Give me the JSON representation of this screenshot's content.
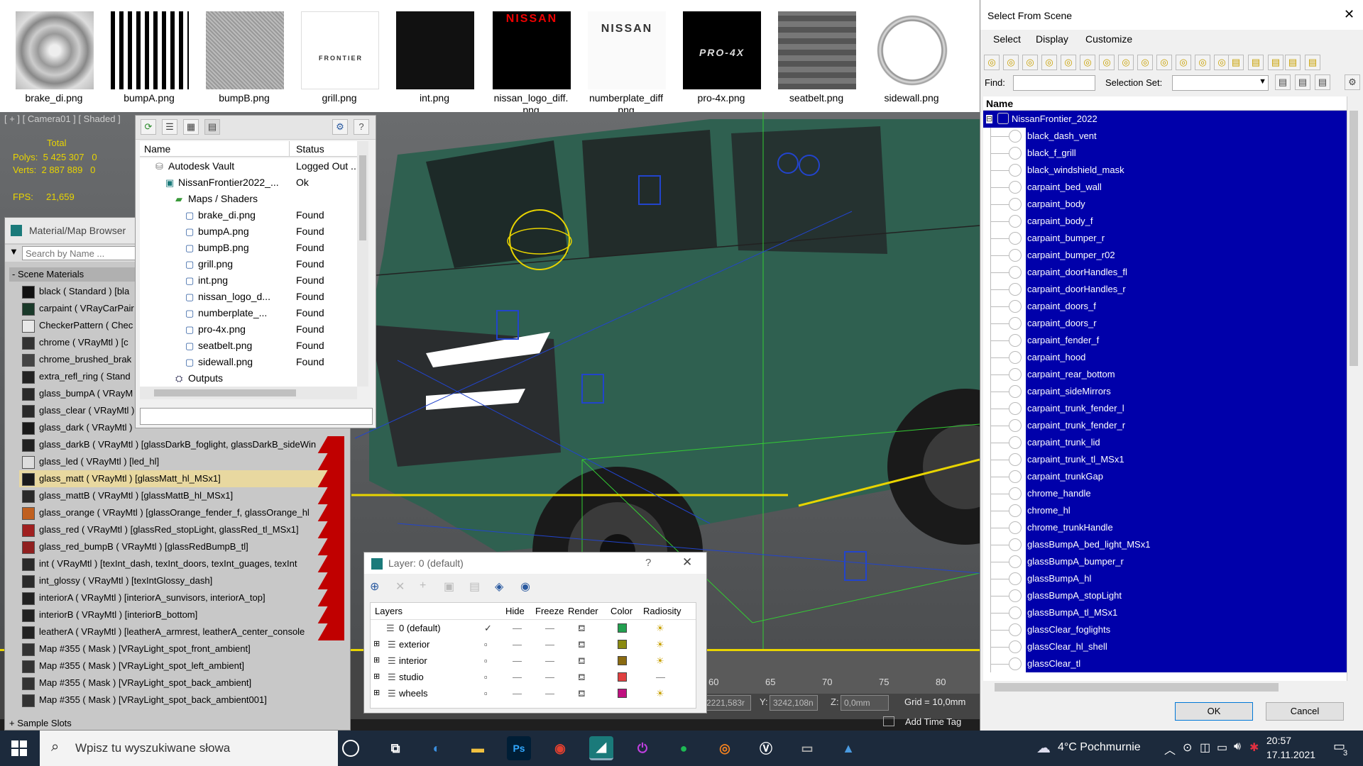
{
  "thumbnails": [
    {
      "caption": "brake_di.png",
      "cap2": ""
    },
    {
      "caption": "bumpA.png",
      "cap2": ""
    },
    {
      "caption": "bumpB.png",
      "cap2": ""
    },
    {
      "caption": "grill.png",
      "cap2": "",
      "text": "FRONTIER"
    },
    {
      "caption": "int.png",
      "cap2": ""
    },
    {
      "caption": "nissan_logo_diff.",
      "cap2": "png",
      "text": "NISSAN"
    },
    {
      "caption": "numberplate_diff",
      "cap2": "png",
      "text": "NISSAN"
    },
    {
      "caption": "pro-4x.png",
      "cap2": "",
      "text": "PRO-4X"
    },
    {
      "caption": "seatbelt.png",
      "cap2": ""
    },
    {
      "caption": "sidewall.png",
      "cap2": ""
    }
  ],
  "viewport": {
    "label": "[ + ] [ Camera01 ] [ Shaded ]",
    "stats_total": "Total",
    "polys_label": "Polys:",
    "polys_value": "5 425 307",
    "polys_sel": "0",
    "verts_label": "Verts:",
    "verts_value": "2 887 889",
    "verts_sel": "0",
    "fps_label": "FPS:",
    "fps_value": "21,659",
    "ruler": [
      "60",
      "65",
      "70",
      "75",
      "80"
    ],
    "coord_x": "2221,583r",
    "coord_y_label": "Y:",
    "coord_y": "3242,108n",
    "coord_z_label": "Z:",
    "coord_z": "0,0mm",
    "grid": "Grid = 10,0mm",
    "add_time_tag": "Add Time Tag"
  },
  "material_browser": {
    "title": "Material/Map Browser",
    "search_placeholder": "Search by Name ...",
    "section": "- Scene Materials",
    "sample_slots": "+ Sample Slots",
    "items": [
      {
        "label": "black ( Standard ) [bla",
        "red": false
      },
      {
        "label": "carpaint ( VRayCarPair",
        "red": false
      },
      {
        "label": "CheckerPattern ( Chec",
        "red": false
      },
      {
        "label": "chrome ( VRayMtl ) [c",
        "red": false
      },
      {
        "label": "chrome_brushed_brak",
        "red": false
      },
      {
        "label": "extra_refl_ring ( Stand",
        "red": false
      },
      {
        "label": "glass_bumpA ( VRayM",
        "red": false
      },
      {
        "label": "glass_clear ( VRayMtl )",
        "red": false
      },
      {
        "label": "glass_dark ( VRayMtl )",
        "red": false
      },
      {
        "label": "glass_darkB ( VRayMtl ) [glassDarkB_foglight, glassDarkB_sideWin",
        "red": true
      },
      {
        "label": "glass_led ( VRayMtl ) [led_hl]",
        "red": true
      },
      {
        "label": "glass_matt ( VRayMtl ) [glassMatt_hl_MSx1]",
        "red": true,
        "highlight": true
      },
      {
        "label": "glass_mattB ( VRayMtl ) [glassMattB_hl_MSx1]",
        "red": true
      },
      {
        "label": "glass_orange ( VRayMtl ) [glassOrange_fender_f, glassOrange_hl",
        "red": true
      },
      {
        "label": "glass_red ( VRayMtl ) [glassRed_stopLight, glassRed_tl_MSx1]",
        "red": true
      },
      {
        "label": "glass_red_bumpB ( VRayMtl ) [glassRedBumpB_tl]",
        "red": true
      },
      {
        "label": "int ( VRayMtl ) [texInt_dash, texInt_doors, texInt_guages, texInt",
        "red": true
      },
      {
        "label": "int_glossy ( VRayMtl ) [texIntGlossy_dash]",
        "red": true
      },
      {
        "label": "interiorA ( VRayMtl ) [interiorA_sunvisors, interiorA_top]",
        "red": true
      },
      {
        "label": "interiorB ( VRayMtl ) [interiorB_bottom]",
        "red": true
      },
      {
        "label": "leatherA ( VRayMtl ) [leatherA_armrest, leatherA_center_console",
        "red": true
      },
      {
        "label": "Map #355 ( Mask ) [VRayLight_spot_front_ambient]",
        "red": false
      },
      {
        "label": "Map #355 ( Mask ) [VRayLight_spot_left_ambient]",
        "red": false
      },
      {
        "label": "Map #355 ( Mask ) [VRayLight_spot_back_ambient]",
        "red": false
      },
      {
        "label": "Map #355 ( Mask ) [VRayLight_spot_back_ambient001]",
        "red": false
      }
    ]
  },
  "asset_tracking": {
    "col_name": "Name",
    "col_status": "Status",
    "rows": [
      {
        "name": "Autodesk Vault",
        "status": "Logged Out ..",
        "indent": 1
      },
      {
        "name": "NissanFrontier2022_...",
        "status": "Ok",
        "indent": 2
      },
      {
        "name": "Maps / Shaders",
        "status": "",
        "indent": 3
      },
      {
        "name": "brake_di.png",
        "status": "Found",
        "indent": 4
      },
      {
        "name": "bumpA.png",
        "status": "Found",
        "indent": 4
      },
      {
        "name": "bumpB.png",
        "status": "Found",
        "indent": 4
      },
      {
        "name": "grill.png",
        "status": "Found",
        "indent": 4
      },
      {
        "name": "int.png",
        "status": "Found",
        "indent": 4
      },
      {
        "name": "nissan_logo_d...",
        "status": "Found",
        "indent": 4
      },
      {
        "name": "numberplate_...",
        "status": "Found",
        "indent": 4
      },
      {
        "name": "pro-4x.png",
        "status": "Found",
        "indent": 4
      },
      {
        "name": "seatbelt.png",
        "status": "Found",
        "indent": 4
      },
      {
        "name": "sidewall.png",
        "status": "Found",
        "indent": 4
      },
      {
        "name": "Outputs",
        "status": "",
        "indent": 3
      }
    ]
  },
  "layer_dialog": {
    "title": "Layer: 0 (default)",
    "help": "?",
    "close": "✕",
    "cols": [
      "Layers",
      "Hide",
      "Freeze",
      "Render",
      "Color",
      "Radiosity"
    ],
    "rows": [
      {
        "name": "0 (default)",
        "color": "#22a050",
        "radiosity": true,
        "current": true
      },
      {
        "name": "exterior",
        "color": "#8a8a10",
        "radiosity": true
      },
      {
        "name": "interior",
        "color": "#8a6a10",
        "radiosity": true
      },
      {
        "name": "studio",
        "color": "#e04040",
        "radiosity": false
      },
      {
        "name": "wheels",
        "color": "#c01080",
        "radiosity": true
      }
    ]
  },
  "scene_dialog": {
    "title": "Select From Scene",
    "close": "✕",
    "menu": [
      "Select",
      "Display",
      "Customize"
    ],
    "find_label": "Find:",
    "selection_set_label": "Selection Set:",
    "col_name": "Name",
    "root": "NissanFrontier_2022",
    "items": [
      "black_dash_vent",
      "black_f_grill",
      "black_windshield_mask",
      "carpaint_bed_wall",
      "carpaint_body",
      "carpaint_body_f",
      "carpaint_bumper_r",
      "carpaint_bumper_r02",
      "carpaint_doorHandles_fl",
      "carpaint_doorHandles_r",
      "carpaint_doors_f",
      "carpaint_doors_r",
      "carpaint_fender_f",
      "carpaint_hood",
      "carpaint_rear_bottom",
      "carpaint_sideMirrors",
      "carpaint_trunk_fender_l",
      "carpaint_trunk_fender_r",
      "carpaint_trunk_lid",
      "carpaint_trunk_tl_MSx1",
      "carpaint_trunkGap",
      "chrome_handle",
      "chrome_hl",
      "chrome_trunkHandle",
      "glassBumpA_bed_light_MSx1",
      "glassBumpA_bumper_r",
      "glassBumpA_hl",
      "glassBumpA_stopLight",
      "glassBumpA_tl_MSx1",
      "glassClear_foglights",
      "glassClear_hl_shell",
      "glassClear_tl"
    ],
    "ok": "OK",
    "cancel": "Cancel"
  },
  "taskbar": {
    "search_placeholder": "Wpisz tu wyszukiwane słowa",
    "weather": "4°C  Pochmurnie",
    "time": "20:57",
    "date": "17.11.2021",
    "notifications": "3"
  }
}
